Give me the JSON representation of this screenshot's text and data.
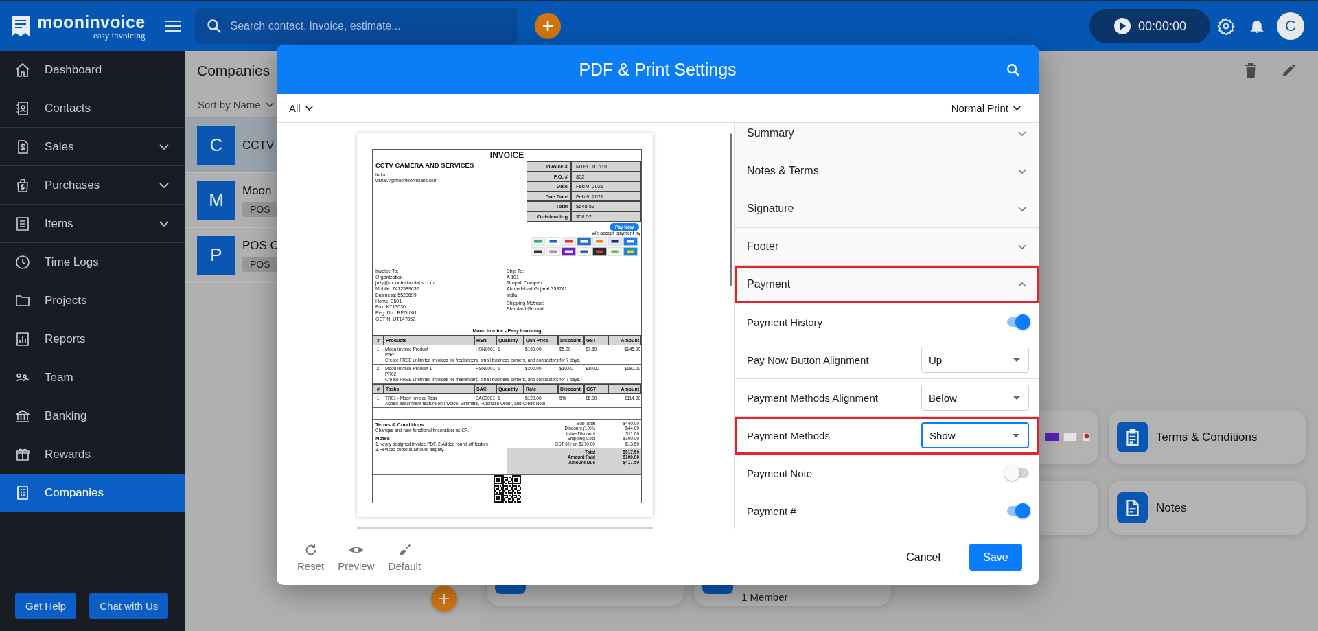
{
  "app": {
    "logo_name": "mooninvoice",
    "logo_tagline": "easy invoicing",
    "search": {
      "placeholder": "Search contact, invoice, estimate..."
    },
    "timer": "00:00:00",
    "avatar": "C"
  },
  "sidebar": {
    "items": [
      {
        "label": "Dashboard",
        "submenu": false,
        "selected": false
      },
      {
        "label": "Contacts",
        "submenu": false,
        "selected": false
      },
      {
        "label": "Sales",
        "submenu": true,
        "selected": false
      },
      {
        "label": "Purchases",
        "submenu": true,
        "selected": false
      },
      {
        "label": "Items",
        "submenu": true,
        "selected": false
      },
      {
        "label": "Time Logs",
        "submenu": false,
        "selected": false
      },
      {
        "label": "Projects",
        "submenu": false,
        "selected": false
      },
      {
        "label": "Reports",
        "submenu": false,
        "selected": false
      },
      {
        "label": "Team",
        "submenu": false,
        "selected": false
      },
      {
        "label": "Banking",
        "submenu": false,
        "selected": false
      },
      {
        "label": "Rewards",
        "submenu": false,
        "selected": false
      },
      {
        "label": "Companies",
        "submenu": false,
        "selected": true
      }
    ],
    "buttons": [
      "Get Help",
      "Chat with Us"
    ]
  },
  "list": {
    "title": "Companies",
    "sort": "Sort by Name",
    "rows": [
      {
        "initial": "C",
        "name": "CCTV",
        "selected": true
      },
      {
        "initial": "M",
        "name": "Moon",
        "tag": "POS",
        "selected": false
      },
      {
        "initial": "P",
        "name": "POS C",
        "tag": "POS",
        "selected": false
      }
    ]
  },
  "detail_cards": [
    {
      "label": "Terms & Conditions"
    },
    {
      "label": "Notes"
    }
  ],
  "member_text": "1 Member",
  "modal": {
    "title": "PDF & Print Settings",
    "filter": "All",
    "print_mode": "Normal Print",
    "settings": [
      {
        "kind": "section",
        "label": "Summary",
        "expanded": false,
        "highlighted": false
      },
      {
        "kind": "section",
        "label": "Notes & Terms",
        "expanded": false,
        "highlighted": false
      },
      {
        "kind": "section",
        "label": "Signature",
        "expanded": false,
        "highlighted": false
      },
      {
        "kind": "section",
        "label": "Footer",
        "expanded": false,
        "highlighted": false
      },
      {
        "kind": "section",
        "label": "Payment",
        "expanded": true,
        "highlighted": true,
        "children": [
          {
            "kind": "toggle",
            "label": "Payment History",
            "on": true,
            "highlighted": false
          },
          {
            "kind": "select",
            "label": "Pay Now Button Alignment",
            "value": "Up",
            "focused": false,
            "highlighted": false
          },
          {
            "kind": "select",
            "label": "Payment Methods Alignment",
            "value": "Below",
            "focused": false,
            "highlighted": false
          },
          {
            "kind": "select",
            "label": "Payment Methods",
            "value": "Show",
            "focused": true,
            "highlighted": true
          },
          {
            "kind": "toggle",
            "label": "Payment Note",
            "on": false,
            "highlighted": false
          },
          {
            "kind": "toggle",
            "label": "Payment #",
            "on": true,
            "highlighted": false
          }
        ]
      }
    ],
    "footer_actions": [
      "Reset",
      "Preview",
      "Default"
    ],
    "cancel": "Cancel",
    "save": "Save"
  },
  "invoice": {
    "title": "INVOICE",
    "company": "CCTV CAMERA AND SERVICES",
    "company_lines": [
      "India",
      "vishal.v@moontechnolabs.com"
    ],
    "meta": [
      {
        "label": "Invoice #",
        "value": "MTPL001619"
      },
      {
        "label": "P.O. #",
        "value": "852"
      },
      {
        "label": "Date",
        "value": "Feb 9, 2021"
      },
      {
        "label": "Due Date",
        "value": "Feb 9, 2021"
      },
      {
        "label": "Total",
        "value": "$648.53"
      },
      {
        "label": "Outstanding",
        "value": "$58.52"
      }
    ],
    "pay_now": "Pay Now",
    "accept_text": "We accept payment by",
    "bill_to": [
      "Invoice To:",
      "Organization",
      "jully@moontechnolabs.com",
      "Mobile: 7412589632",
      "Business: 5523699",
      "Home: 3501",
      "Fax: KT13030",
      "Reg. No : REG 001",
      "GSTIN: UT147852"
    ],
    "ship_to": [
      "Ship To:",
      "A 101",
      "Tirupati Complex",
      "Ahmedabad Gujarat 358741",
      "India"
    ],
    "shipping": [
      "Shipping Method:",
      "Standard Ground"
    ],
    "subtitle": "Moon Invoice - Easy Invoicing",
    "product_columns": [
      "#",
      "Products",
      "HSN",
      "Quantity",
      "Unit Price",
      "Discount",
      "GST",
      "Amount"
    ],
    "products": [
      {
        "no": "1.",
        "name": "Moon Invoice Product",
        "code": "PR01",
        "description": "Create FREE unlimited invoices for freelancers, small business owners, and contractors for 7 days.",
        "cells": [
          "HSN0001",
          "1",
          "$150.00",
          "$5.00",
          "$7.50",
          "$145.00"
        ]
      },
      {
        "no": "2.",
        "name": "Moon Invoice Product 1",
        "code": "PR02",
        "description": "Create FREE unlimited invoices for freelancers, small business owners, and contractors for 7 days.",
        "cells": [
          "HSN0001",
          "1",
          "$200.00",
          "$10.00",
          "$10.00",
          "$190.00"
        ]
      }
    ],
    "task_columns": [
      "#",
      "Tasks",
      "SAC",
      "Quantity",
      "Rate",
      "Discount",
      "GST",
      "Amount"
    ],
    "tasks": [
      {
        "no": "1.",
        "name": "TR01 - Moon Invoice Task",
        "description": "Added attachment feature on Invoice, Estimate, Purchase Order, and Credit Note.",
        "cells": [
          "SAC0001",
          "1",
          "$120.00",
          "5%",
          "$6.00",
          "$114.00"
        ]
      }
    ],
    "terms_title": "Terms & Conditions",
    "terms": "Changes and new functionality consider as CR.",
    "notes_title": "Notes",
    "notes": [
      "1.Newly designed invoice PDF. 2.Added round off feature.",
      "3.Revised subtotal amount display."
    ],
    "summary": [
      {
        "label": "Sub Total",
        "value": "$440.00"
      },
      {
        "label": "Discount (10%)",
        "value": "$44.00"
      },
      {
        "label": "Inline Discount",
        "value": "$11.00"
      },
      {
        "label": "Shipping Cost",
        "value": "$100.00"
      },
      {
        "label": "GST 5% on $270.00",
        "value": "$13.50"
      }
    ],
    "totals": [
      {
        "label": "Total",
        "value": "$517.50"
      },
      {
        "label": "Amount Paid",
        "value": "$100.00"
      },
      {
        "label": "Amount Due",
        "value": "$417.50"
      }
    ]
  }
}
